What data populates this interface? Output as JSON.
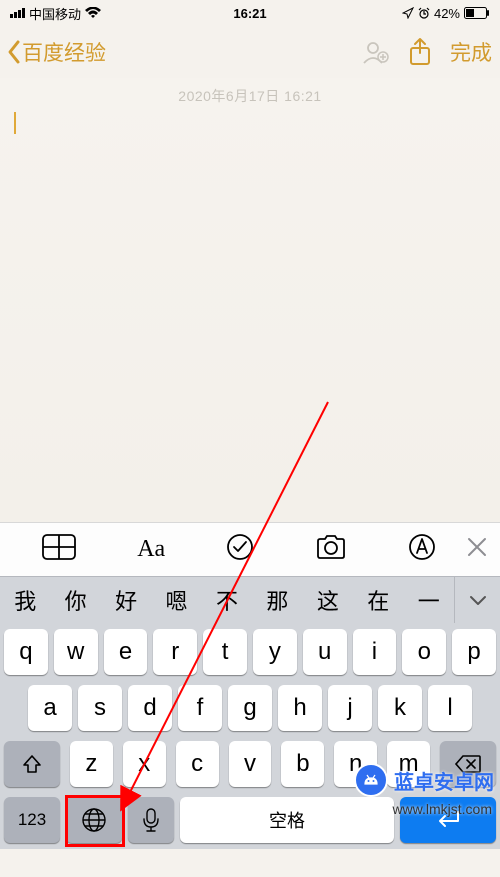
{
  "status": {
    "carrier": "中国移动",
    "time": "16:21",
    "battery_pct": "42%"
  },
  "nav": {
    "back_label": "百度经验",
    "done_label": "完成"
  },
  "content": {
    "date_text": "2020年6月17日 16:21"
  },
  "format_toolbar": {
    "items": [
      "table",
      "text-style",
      "checklist",
      "camera",
      "markup"
    ],
    "text_style_label": "Aa"
  },
  "candidates": {
    "items": [
      "我",
      "你",
      "好",
      "嗯",
      "不",
      "那",
      "这",
      "在",
      "一"
    ]
  },
  "keyboard": {
    "row1": [
      "q",
      "w",
      "e",
      "r",
      "t",
      "y",
      "u",
      "i",
      "o",
      "p"
    ],
    "row2": [
      "a",
      "s",
      "d",
      "f",
      "g",
      "h",
      "j",
      "k",
      "l"
    ],
    "row3": [
      "z",
      "x",
      "c",
      "v",
      "b",
      "n",
      "m"
    ],
    "k123": "123",
    "space": "空格",
    "return_label": "return"
  },
  "watermark": {
    "brand": "蓝卓安卓网",
    "url": "www.lmkjst.com"
  }
}
